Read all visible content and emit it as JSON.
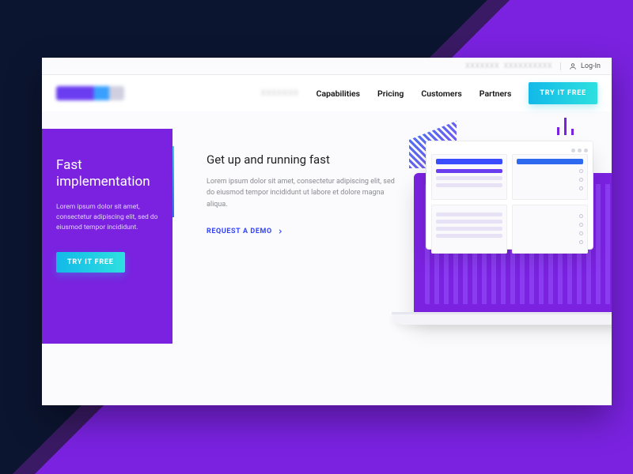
{
  "util": {
    "login_label": "Log-In"
  },
  "nav": {
    "items": [
      {
        "label": "Capabilities"
      },
      {
        "label": "Pricing"
      },
      {
        "label": "Customers"
      },
      {
        "label": "Partners"
      }
    ],
    "cta_label": "TRY IT FREE"
  },
  "side": {
    "title": "Fast implementation",
    "body": "Lorem ipsum dolor sit amet, consectetur adipiscing elit, sed do eiusmod tempor incididunt.",
    "cta_label": "TRY IT FREE"
  },
  "center": {
    "title": "Get up and running fast",
    "body": "Lorem ipsum dolor sit amet, consectetur adipiscing elit, sed do eiusmod tempor incididunt ut labore et dolore magna aliqua.",
    "demo_label": "REQUEST A DEMO"
  },
  "colors": {
    "brand_purple": "#7a22e0",
    "brand_blue": "#3143ff",
    "cta_gradient_from": "#12b9e8",
    "cta_gradient_to": "#2ee0df"
  }
}
